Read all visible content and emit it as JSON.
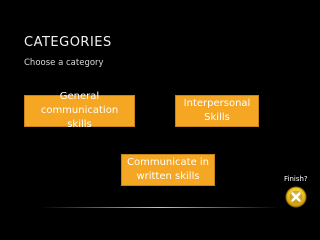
{
  "slide": {
    "title": "CATEGORIES",
    "subtitle": "Choose a category"
  },
  "categories": {
    "general": "General\ncommunication skills",
    "interpersonal": "Interpersonal\nSkills",
    "written": "Communicate in\nwritten skills"
  },
  "finish": {
    "label": "Finish?",
    "icon": "close-x-icon"
  },
  "colors": {
    "background": "#000000",
    "button_fill": "#f5a623",
    "button_border": "#c8841a",
    "finish_fill": "#f0c419"
  }
}
